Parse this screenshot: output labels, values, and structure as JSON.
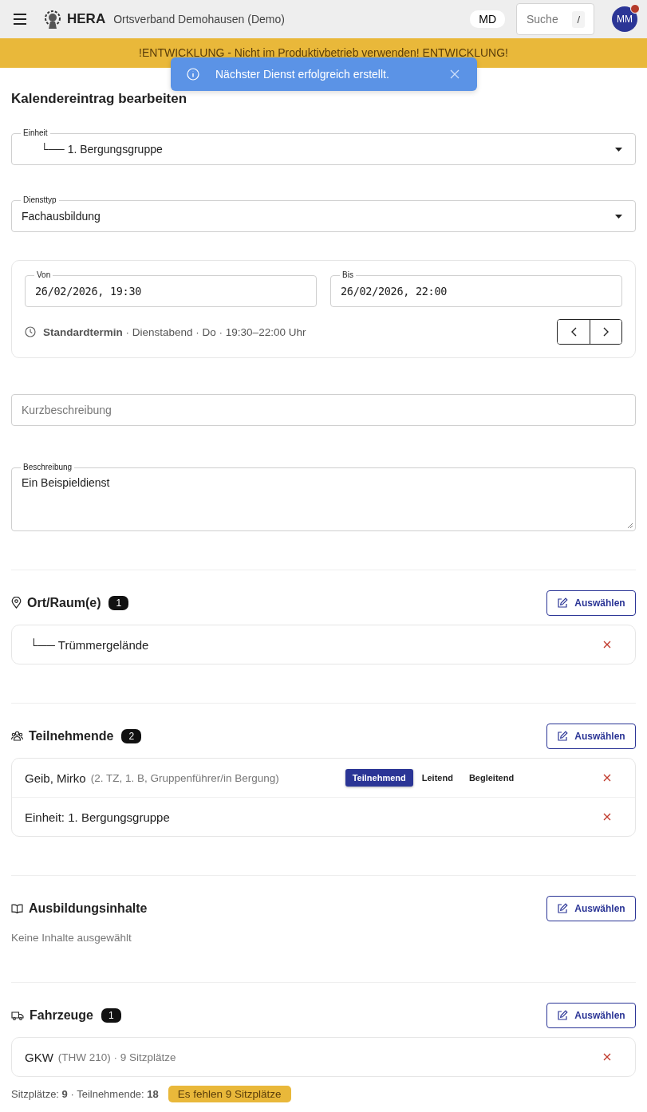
{
  "header": {
    "brand": "HERA",
    "organization": "Ortsverband Demohausen (Demo)",
    "unit_switch": "MD",
    "search": {
      "placeholder": "Suche",
      "shortcut": "/"
    },
    "avatar": {
      "initials": "MM",
      "notification": true
    }
  },
  "banner": "!ENTWICKLUNG - Nicht im Produktivbetrieb verwenden! ENTWICKLUNG!",
  "toast": {
    "message": "Nächster Dienst erfolgreich erstellt."
  },
  "page_title": "Kalendereintrag bearbeiten",
  "unit_field": {
    "label": "Einheit",
    "value": "└── 1. Bergungsgruppe"
  },
  "type_field": {
    "label": "Diensttyp",
    "value": "Fachausbildung"
  },
  "schedule": {
    "from": {
      "label": "Von",
      "value": "26/02/2026, 19:30"
    },
    "to": {
      "label": "Bis",
      "value": "26/02/2026, 22:00"
    },
    "standard": "**Standardtermin** · Dienstabend · Do · 19:30–22:00 Uhr"
  },
  "short_description": {
    "placeholder": "Kurzbeschreibung"
  },
  "description": {
    "label": "Beschreibung",
    "value": "Ein Beispieldienst"
  },
  "sections": [
    {
      "kind": "location",
      "title": "Ort/Raum(e)",
      "count": "1",
      "button": "Auswählen",
      "items": [
        {
          "kind": "tree",
          "label": "└── Trümmergelände"
        }
      ]
    },
    {
      "kind": "participants",
      "title": "Teilnehmende",
      "count": "2",
      "button": "Auswählen",
      "items": [
        {
          "kind": "person",
          "label": "Geib, Mirko",
          "detail": "(2. TZ, 1. B, Gruppenführer/in Bergung)",
          "roles": [
            {
              "label": "Teilnehmend",
              "selected": true
            },
            {
              "label": "Leitend",
              "selected": false
            },
            {
              "label": "Begleitend",
              "selected": false
            }
          ]
        },
        {
          "kind": "unit",
          "label": "Einheit: 1. Bergungsgruppe"
        }
      ]
    },
    {
      "kind": "training",
      "title": "Ausbildungsinhalte",
      "button": "Auswählen",
      "empty_text": "Keine Inhalte ausgewählt"
    },
    {
      "kind": "vehicles",
      "title": "Fahrzeuge",
      "count": "1",
      "button": "Auswählen",
      "items": [
        {
          "kind": "vehicle",
          "label": "GKW",
          "detail": "(THW 210) · 9 Sitzplätze"
        }
      ],
      "summary": "Sitzplätze: **9** · Teilnehmende: **18**",
      "warning": "Es fehlen 9 Sitzplätze"
    }
  ]
}
